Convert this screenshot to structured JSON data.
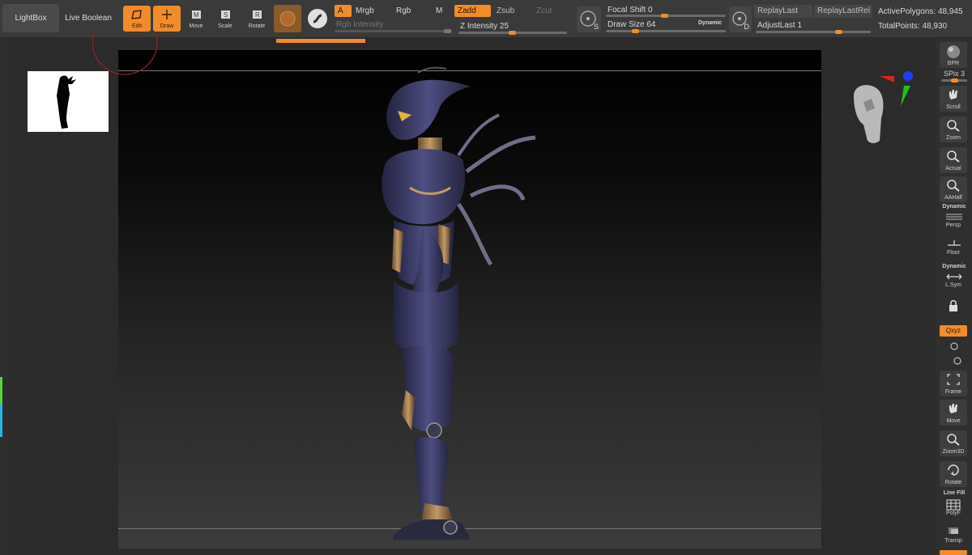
{
  "topbar": {
    "lightbox": "LightBox",
    "live_boolean": "Live Boolean",
    "tools": {
      "edit": "Edit",
      "draw": "Draw",
      "move": "Move",
      "scale": "Scale",
      "rotate": "Rotate"
    },
    "color_a": "A",
    "mrgb": "Mrgb",
    "rgb": "Rgb",
    "m": "M",
    "rgb_intensity": "Rgb Intensity",
    "zadd": "Zadd",
    "zsub": "Zsub",
    "zcut": "Zcut",
    "z_intensity_label": "Z Intensity",
    "z_intensity_value": "25",
    "focal_shift_label": "Focal Shift",
    "focal_shift_value": "0",
    "draw_size_label": "Draw Size",
    "draw_size_value": "64",
    "dynamic": "Dynamic",
    "s_key": "S",
    "d_key": "D",
    "replay_last": "ReplayLast",
    "replay_last_rel": "ReplayLastRel",
    "adjust_last_label": "AdjustLast",
    "adjust_last_value": "1",
    "active_polygons_label": "ActivePolygons:",
    "active_polygons_value": "48,945",
    "total_points_label": "TotalPoints:",
    "total_points_value": "48,930"
  },
  "colors": {
    "accent": "#f08c2a",
    "panel": "#3a3a3a",
    "tray": "#2f2f2f"
  },
  "right_tray": {
    "bpr": "BPR",
    "spix_label": "SPix",
    "spix_value": "3",
    "scroll": "Scroll",
    "zoom": "Zoom",
    "actual": "Actual",
    "aahalf": "AAHalf",
    "dynamic": "Dynamic",
    "persp": "Persp",
    "floor": "Floor",
    "dynamic2": "Dynamic",
    "lsym": "L.Sym",
    "xyz": "Qxyz",
    "frame": "Frame",
    "move": "Move",
    "zoom3d": "Zoom3D",
    "rotate": "Rotate",
    "line_fill": "Line Fill",
    "polyf": "PolyF",
    "transp": "Transp"
  },
  "icons": [
    "edit-icon",
    "draw-icon",
    "move-icon",
    "scale-icon",
    "rotate-icon",
    "material-sphere-icon",
    "stroke-icon",
    "focal-icon",
    "hand-icon",
    "magnifier-icon",
    "head-navigator-icon"
  ]
}
